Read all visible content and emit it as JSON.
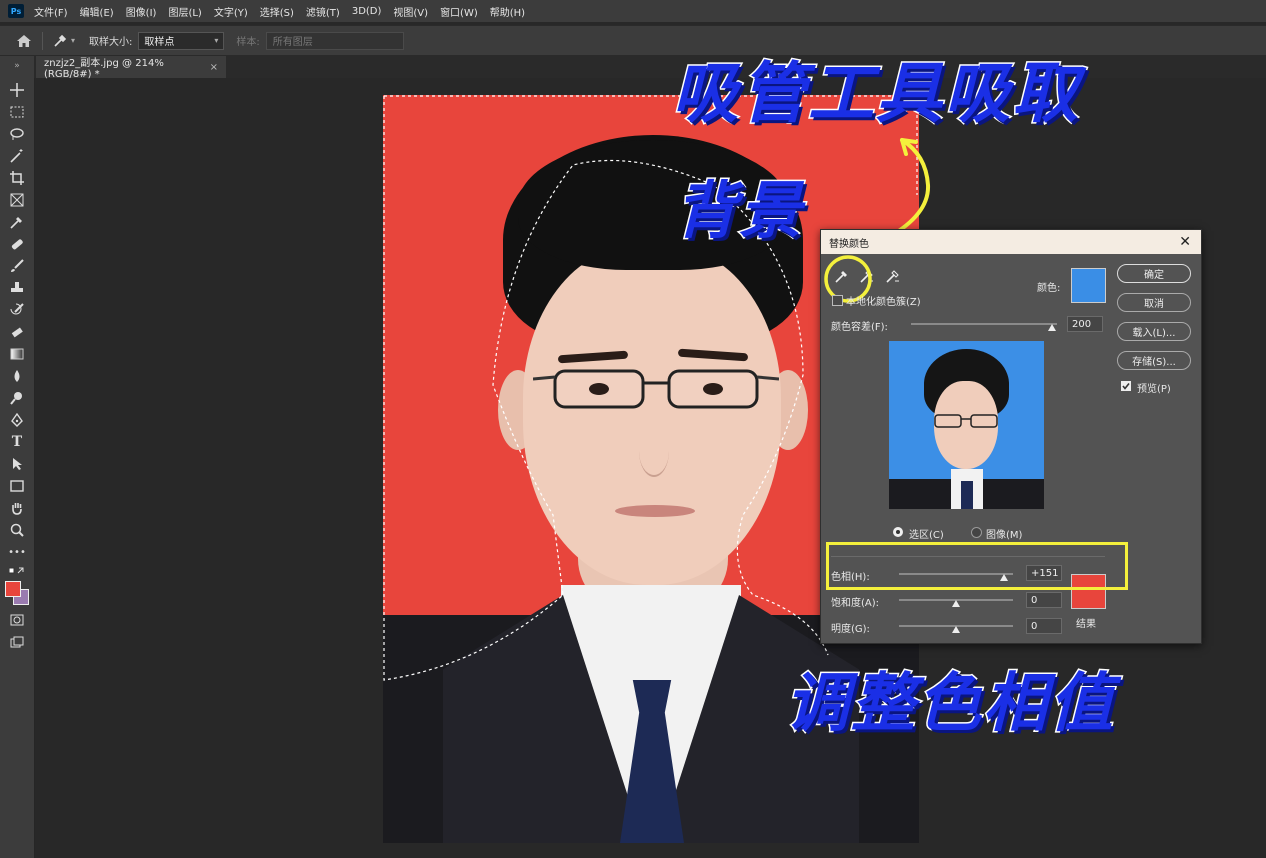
{
  "app": {
    "logo": "Ps"
  },
  "menu": [
    "文件(F)",
    "编辑(E)",
    "图像(I)",
    "图层(L)",
    "文字(Y)",
    "选择(S)",
    "滤镜(T)",
    "3D(D)",
    "视图(V)",
    "窗口(W)",
    "帮助(H)"
  ],
  "options": {
    "sample_size_label": "取样大小:",
    "sample_size_value": "取样点",
    "sample_label": "样本:",
    "sample_value": "所有图层"
  },
  "document": {
    "tab_title": "znzjz2_副本.jpg @ 214%(RGB/8#) *",
    "close": "×"
  },
  "annotations": {
    "top_line1": "吸管工具吸取",
    "top_line2": "背景",
    "bottom": "调整色相值"
  },
  "dialog": {
    "title": "替换颜色",
    "close": "✕",
    "localized_label": "本地化颜色簇(Z)",
    "color_label": "颜色:",
    "fuzziness_label": "颜色容差(F):",
    "fuzziness_value": "200",
    "radio_selection": "选区(C)",
    "radio_image": "图像(M)",
    "hue_label": "色相(H):",
    "hue_value": "+151",
    "saturation_label": "饱和度(A):",
    "saturation_value": "0",
    "lightness_label": "明度(G):",
    "lightness_value": "0",
    "result_label": "结果",
    "buttons": {
      "ok": "确定",
      "cancel": "取消",
      "load": "载入(L)...",
      "save": "存储(S)..."
    },
    "preview_label": "预览(P)",
    "preview_checked": true,
    "colors": {
      "selected": "#3a8ee6",
      "result": "#e8453c"
    },
    "fuzziness_fraction": 1.0,
    "hue_fraction": 0.92,
    "saturation_fraction": 0.5,
    "lightness_fraction": 0.5
  },
  "colors": {
    "foreground": "#e8453c",
    "background": "#9a7bb0",
    "annotation_text": "#1a2fe6",
    "highlight": "#f4f03c"
  }
}
